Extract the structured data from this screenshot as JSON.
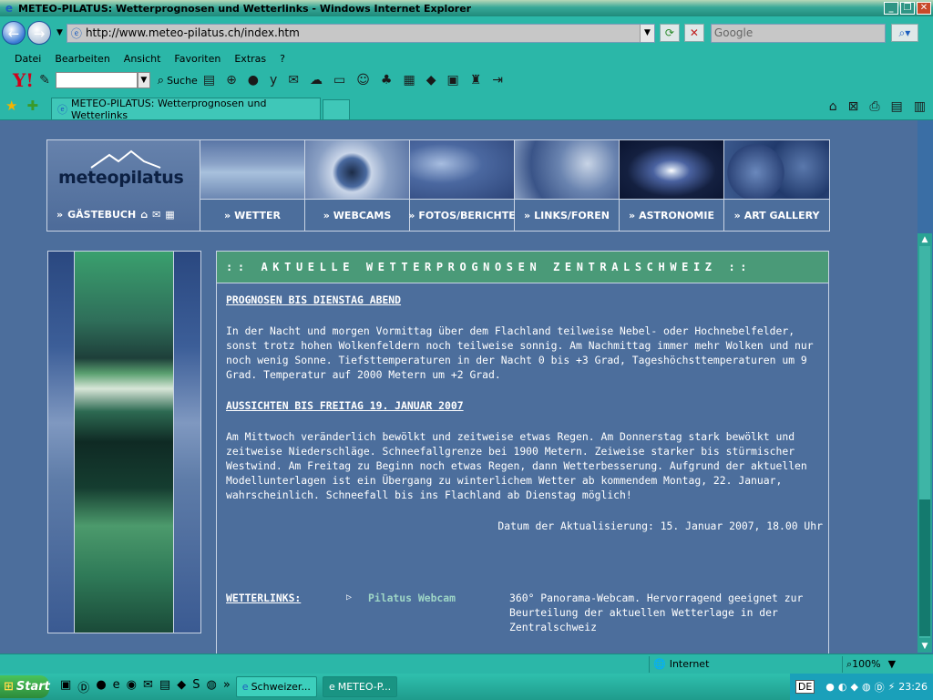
{
  "window": {
    "title": "METEO-PILATUS: Wetterprognosen und Wetterlinks - Windows Internet Explorer"
  },
  "browser": {
    "url": "http://www.meteo-pilatus.ch/index.htm",
    "search_placeholder": "Google",
    "menu": [
      "Datei",
      "Bearbeiten",
      "Ansicht",
      "Favoriten",
      "Extras",
      "?"
    ],
    "toolbar_search_label": "Suche",
    "tab_title": "METEO-PILATUS: Wetterprognosen und Wetterlinks",
    "status_zone": "Internet",
    "zoom": "100%"
  },
  "site": {
    "logo": "meteopilatus",
    "guestbook": "GÄSTEBUCH",
    "nav": [
      "WETTER",
      "WEBCAMS",
      "FOTOS/BERICHTE",
      "LINKS/FOREN",
      "ASTRONOMIE",
      "ART GALLERY"
    ],
    "content_header": ":: AKTUELLE WETTERPROGNOSEN ZENTRALSCHWEIZ ::",
    "forecast_title": "PROGNOSEN BIS DIENSTAG ABEND",
    "forecast_text": "In der Nacht und morgen Vormittag über dem Flachland teilweise Nebel- oder Hochnebelfelder, sonst trotz hohen Wolkenfeldern noch teilweise sonnig. Am Nachmittag immer mehr Wolken und nur noch wenig Sonne. Tiefsttemperaturen in der Nacht 0 bis +3 Grad, Tageshöchsttemperaturen um 9 Grad. Temperatur auf 2000 Metern um +2 Grad.",
    "outlook_title": "AUSSICHTEN BIS FREITAG 19. JANUAR 2007",
    "outlook_text": "Am Mittwoch veränderlich bewölkt und zeitweise etwas Regen. Am Donnerstag stark bewölkt und zeitweise Niederschläge. Schneefallgrenze bei 1900 Metern. Zeiweise starker bis stürmischer Westwind. Am Freitag zu Beginn noch etwas Regen, dann Wetterbesserung. Aufgrund der aktuellen Modellunterlagen ist ein Übergang zu winterlichem Wetter ab kommendem Montag, 22. Januar, wahrscheinlich. Schneefall bis ins Flachland ab Dienstag möglich!",
    "update": "Datum der Aktualisierung: 15. Januar 2007, 18.00 Uhr",
    "links_label": "WETTERLINKS:",
    "link_name": "Pilatus Webcam",
    "link_desc": "360° Panorama-Webcam. Hervorragend geeignet zur Beurteilung der aktuellen Wetterlage in der Zentralschweiz"
  },
  "taskbar": {
    "start": "Start",
    "tasks": [
      "Schweizer...",
      "METEO-P..."
    ],
    "lang": "DE",
    "time": "23:26"
  }
}
